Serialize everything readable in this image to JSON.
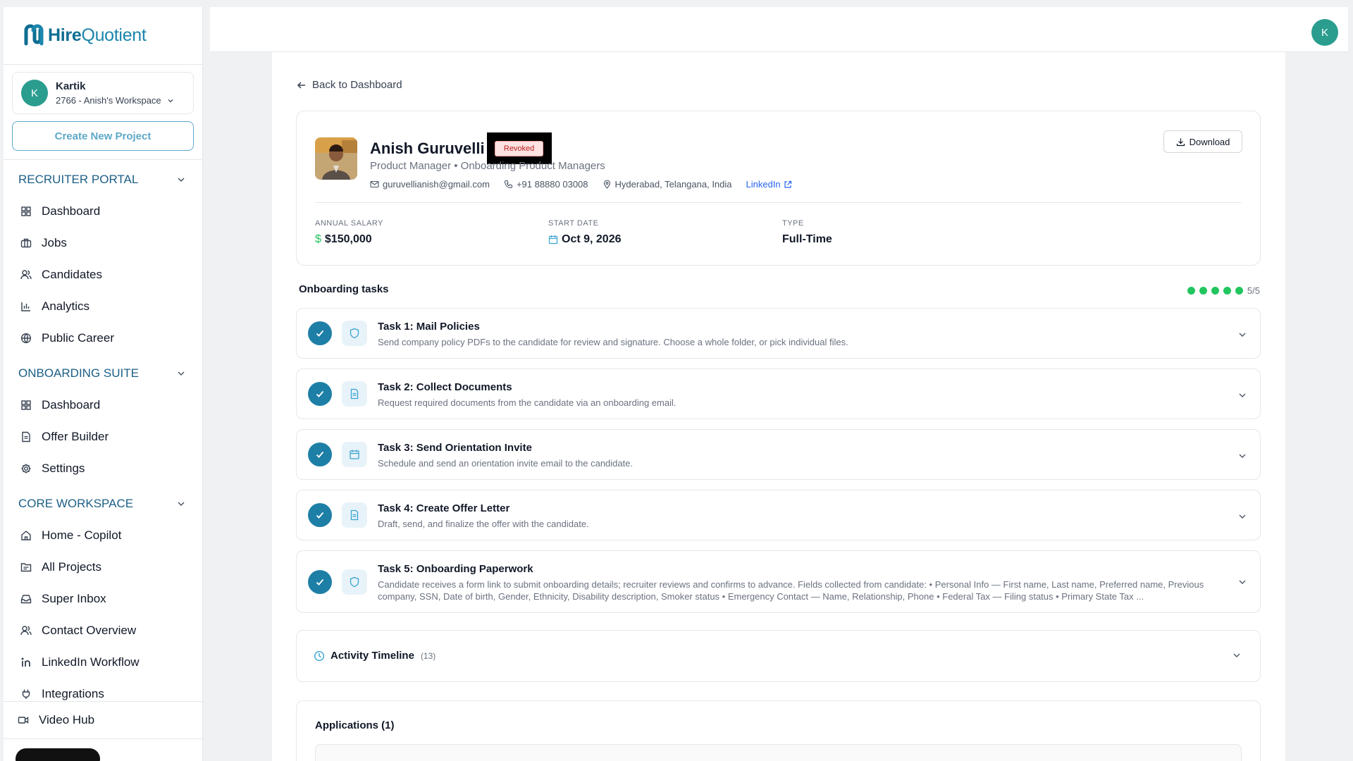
{
  "brand": {
    "name_part1": "Hire",
    "name_part2": "Quotient",
    "color": "#0e6e92"
  },
  "workspace": {
    "avatar_letter": "K",
    "user": "Kartik",
    "name": "2766 - Anish's Workspace"
  },
  "sidebar": {
    "create_button": "Create New Project",
    "sections": [
      {
        "title": "RECRUITER PORTAL",
        "items": [
          "Dashboard",
          "Jobs",
          "Candidates",
          "Analytics",
          "Public Career"
        ]
      },
      {
        "title": "ONBOARDING SUITE",
        "items": [
          "Dashboard",
          "Offer Builder",
          "Settings"
        ]
      },
      {
        "title": "CORE WORKSPACE",
        "items": [
          "Home - Copilot",
          "All Projects",
          "Super Inbox",
          "Contact Overview",
          "LinkedIn Workflow",
          "Integrations"
        ]
      }
    ],
    "bottom_item": "Video Hub"
  },
  "topbar": {
    "avatar_letter": "K"
  },
  "back_link": "Back to Dashboard",
  "candidate": {
    "name": "Anish Guruvelli",
    "status": "Revoked",
    "role": "Product Manager • Onboarding Product Managers",
    "email": "guruvellianish@gmail.com",
    "phone": "+91 88880 03008",
    "location": "Hyderabad, Telangana, India",
    "linkedin": "LinkedIn",
    "download_label": "Download",
    "salary_label": "ANNUAL SALARY",
    "salary_value": "$150,000",
    "start_label": "START DATE",
    "start_value": "Oct 9, 2026",
    "type_label": "TYPE",
    "type_value": "Full-Time"
  },
  "tasks": {
    "header": "Onboarding tasks",
    "progress_text": "5/5",
    "completed": 5,
    "total": 5,
    "items": [
      {
        "title": "Task 1: Mail Policies",
        "desc": "Send company policy PDFs to the candidate for review and signature. Choose a whole folder, or pick individual files.",
        "icon": "shield-icon"
      },
      {
        "title": "Task 2: Collect Documents",
        "desc": "Request required documents from the candidate via an onboarding email.",
        "icon": "document-icon"
      },
      {
        "title": "Task 3: Send Orientation Invite",
        "desc": "Schedule and send an orientation invite email to the candidate.",
        "icon": "calendar-icon"
      },
      {
        "title": "Task 4: Create Offer Letter",
        "desc": "Draft, send, and finalize the offer with the candidate.",
        "icon": "document-icon"
      },
      {
        "title": "Task 5: Onboarding Paperwork",
        "desc": "Candidate receives a form link to submit onboarding details; recruiter reviews and confirms to advance. Fields collected from candidate: • Personal Info — First name, Last name, Preferred name, Previous company, SSN, Date of birth, Gender, Ethnicity, Disability description, Smoker status • Emergency Contact — Name, Relationship, Phone • Federal Tax — Filing status • Primary State Tax ...",
        "icon": "shield-icon"
      }
    ]
  },
  "timeline": {
    "label": "Activity Timeline",
    "count": "(13)"
  },
  "applications": {
    "title": "Applications (1)"
  }
}
